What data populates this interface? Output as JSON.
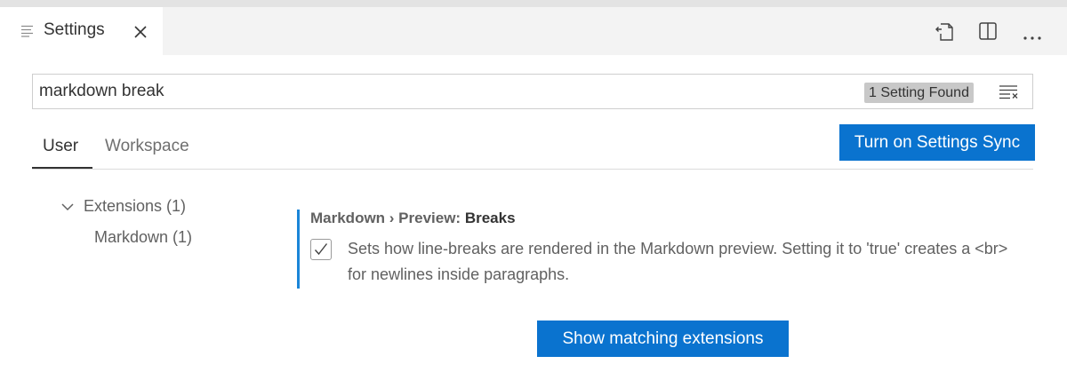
{
  "editor_tab": {
    "label": "Settings",
    "icon": "settings-file-icon",
    "close_icon": "close-icon"
  },
  "actions": [
    {
      "name": "open-settings-json-icon"
    },
    {
      "name": "split-editor-icon"
    },
    {
      "name": "more-actions-icon"
    }
  ],
  "search": {
    "value": "markdown break",
    "result_count": "1 Setting Found",
    "clear_icon": "clear-filter-icon"
  },
  "scope_tabs": {
    "user": "User",
    "workspace": "Workspace",
    "active": "User"
  },
  "sync_button": "Turn on Settings Sync",
  "toc": {
    "group": "Extensions (1)",
    "group_expanded": true,
    "item": "Markdown (1)"
  },
  "setting": {
    "category": "Markdown › Preview: ",
    "key": "Breaks",
    "checked": true,
    "description": "Sets how line-breaks are rendered in the Markdown preview. Setting it to 'true' creates a <br> for newlines inside paragraphs."
  },
  "extensions_button": "Show matching extensions",
  "colors": {
    "accent": "#0a73cf",
    "modified_indicator": "#1a85d8"
  }
}
